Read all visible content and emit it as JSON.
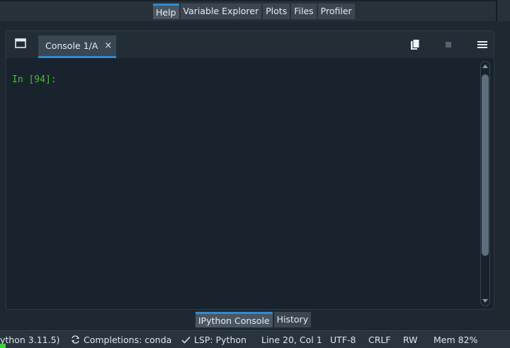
{
  "top_tabs": [
    {
      "label": "Help",
      "active": true
    },
    {
      "label": "Variable Explorer",
      "active": false
    },
    {
      "label": "Plots",
      "active": false
    },
    {
      "label": "Files",
      "active": false
    },
    {
      "label": "Profiler",
      "active": false
    }
  ],
  "console": {
    "tab_label": "Console 1/A",
    "close_glyph": "×",
    "prompt": "In [94]:",
    "icons": {
      "undock": "undock-window-icon",
      "copy": "copy-icon",
      "stop": "stop-icon",
      "menu": "hamburger-menu-icon"
    }
  },
  "bottom_tabs": [
    {
      "label": "IPython Console",
      "active": true
    },
    {
      "label": "History",
      "active": false
    }
  ],
  "status_bar": {
    "python": "ython 3.11.5)",
    "completions": "Completions: conda",
    "lsp": "LSP: Python",
    "position": "Line 20, Col 1",
    "encoding": "UTF-8",
    "eol": "CRLF",
    "permissions": "RW",
    "memory": "Mem 82%"
  },
  "colors": {
    "accent": "#2f8bd3",
    "prompt": "#45c22e",
    "background": "#19232d"
  }
}
